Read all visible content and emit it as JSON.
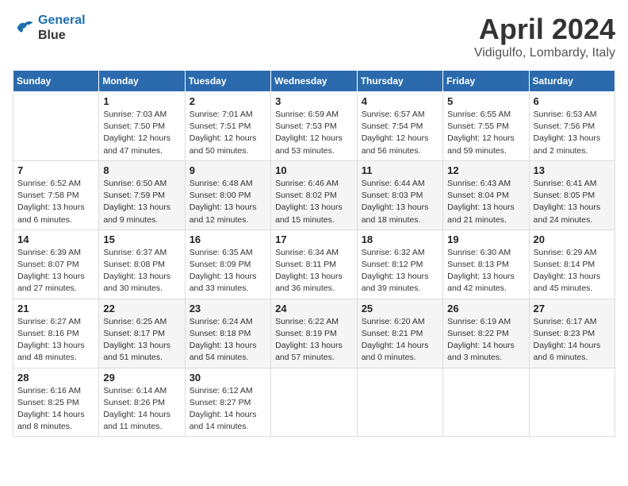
{
  "header": {
    "logo_line1": "General",
    "logo_line2": "Blue",
    "month": "April 2024",
    "location": "Vidigulfo, Lombardy, Italy"
  },
  "weekdays": [
    "Sunday",
    "Monday",
    "Tuesday",
    "Wednesday",
    "Thursday",
    "Friday",
    "Saturday"
  ],
  "weeks": [
    [
      {
        "day": "",
        "sunrise": "",
        "sunset": "",
        "daylight": ""
      },
      {
        "day": "1",
        "sunrise": "7:03 AM",
        "sunset": "7:50 PM",
        "daylight": "12 hours and 47 minutes."
      },
      {
        "day": "2",
        "sunrise": "7:01 AM",
        "sunset": "7:51 PM",
        "daylight": "12 hours and 50 minutes."
      },
      {
        "day": "3",
        "sunrise": "6:59 AM",
        "sunset": "7:53 PM",
        "daylight": "12 hours and 53 minutes."
      },
      {
        "day": "4",
        "sunrise": "6:57 AM",
        "sunset": "7:54 PM",
        "daylight": "12 hours and 56 minutes."
      },
      {
        "day": "5",
        "sunrise": "6:55 AM",
        "sunset": "7:55 PM",
        "daylight": "12 hours and 59 minutes."
      },
      {
        "day": "6",
        "sunrise": "6:53 AM",
        "sunset": "7:56 PM",
        "daylight": "13 hours and 2 minutes."
      }
    ],
    [
      {
        "day": "7",
        "sunrise": "6:52 AM",
        "sunset": "7:58 PM",
        "daylight": "13 hours and 6 minutes."
      },
      {
        "day": "8",
        "sunrise": "6:50 AM",
        "sunset": "7:59 PM",
        "daylight": "13 hours and 9 minutes."
      },
      {
        "day": "9",
        "sunrise": "6:48 AM",
        "sunset": "8:00 PM",
        "daylight": "13 hours and 12 minutes."
      },
      {
        "day": "10",
        "sunrise": "6:46 AM",
        "sunset": "8:02 PM",
        "daylight": "13 hours and 15 minutes."
      },
      {
        "day": "11",
        "sunrise": "6:44 AM",
        "sunset": "8:03 PM",
        "daylight": "13 hours and 18 minutes."
      },
      {
        "day": "12",
        "sunrise": "6:43 AM",
        "sunset": "8:04 PM",
        "daylight": "13 hours and 21 minutes."
      },
      {
        "day": "13",
        "sunrise": "6:41 AM",
        "sunset": "8:05 PM",
        "daylight": "13 hours and 24 minutes."
      }
    ],
    [
      {
        "day": "14",
        "sunrise": "6:39 AM",
        "sunset": "8:07 PM",
        "daylight": "13 hours and 27 minutes."
      },
      {
        "day": "15",
        "sunrise": "6:37 AM",
        "sunset": "8:08 PM",
        "daylight": "13 hours and 30 minutes."
      },
      {
        "day": "16",
        "sunrise": "6:35 AM",
        "sunset": "8:09 PM",
        "daylight": "13 hours and 33 minutes."
      },
      {
        "day": "17",
        "sunrise": "6:34 AM",
        "sunset": "8:11 PM",
        "daylight": "13 hours and 36 minutes."
      },
      {
        "day": "18",
        "sunrise": "6:32 AM",
        "sunset": "8:12 PM",
        "daylight": "13 hours and 39 minutes."
      },
      {
        "day": "19",
        "sunrise": "6:30 AM",
        "sunset": "8:13 PM",
        "daylight": "13 hours and 42 minutes."
      },
      {
        "day": "20",
        "sunrise": "6:29 AM",
        "sunset": "8:14 PM",
        "daylight": "13 hours and 45 minutes."
      }
    ],
    [
      {
        "day": "21",
        "sunrise": "6:27 AM",
        "sunset": "8:16 PM",
        "daylight": "13 hours and 48 minutes."
      },
      {
        "day": "22",
        "sunrise": "6:25 AM",
        "sunset": "8:17 PM",
        "daylight": "13 hours and 51 minutes."
      },
      {
        "day": "23",
        "sunrise": "6:24 AM",
        "sunset": "8:18 PM",
        "daylight": "13 hours and 54 minutes."
      },
      {
        "day": "24",
        "sunrise": "6:22 AM",
        "sunset": "8:19 PM",
        "daylight": "13 hours and 57 minutes."
      },
      {
        "day": "25",
        "sunrise": "6:20 AM",
        "sunset": "8:21 PM",
        "daylight": "14 hours and 0 minutes."
      },
      {
        "day": "26",
        "sunrise": "6:19 AM",
        "sunset": "8:22 PM",
        "daylight": "14 hours and 3 minutes."
      },
      {
        "day": "27",
        "sunrise": "6:17 AM",
        "sunset": "8:23 PM",
        "daylight": "14 hours and 6 minutes."
      }
    ],
    [
      {
        "day": "28",
        "sunrise": "6:16 AM",
        "sunset": "8:25 PM",
        "daylight": "14 hours and 8 minutes."
      },
      {
        "day": "29",
        "sunrise": "6:14 AM",
        "sunset": "8:26 PM",
        "daylight": "14 hours and 11 minutes."
      },
      {
        "day": "30",
        "sunrise": "6:12 AM",
        "sunset": "8:27 PM",
        "daylight": "14 hours and 14 minutes."
      },
      {
        "day": "",
        "sunrise": "",
        "sunset": "",
        "daylight": ""
      },
      {
        "day": "",
        "sunrise": "",
        "sunset": "",
        "daylight": ""
      },
      {
        "day": "",
        "sunrise": "",
        "sunset": "",
        "daylight": ""
      },
      {
        "day": "",
        "sunrise": "",
        "sunset": "",
        "daylight": ""
      }
    ]
  ],
  "labels": {
    "sunrise_prefix": "Sunrise: ",
    "sunset_prefix": "Sunset: ",
    "daylight_prefix": "Daylight: "
  }
}
